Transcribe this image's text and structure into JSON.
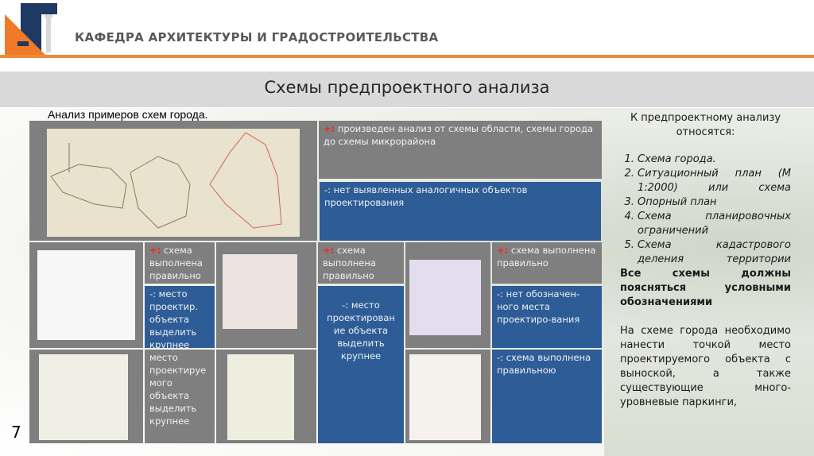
{
  "header": {
    "department": "КАФЕДРА АРХИТЕКТУРЫ И ГРАДОСТРОИТЕЛЬСТВА",
    "logo_text": "АГ"
  },
  "slide": {
    "title": "Схемы предпроектного анализа",
    "subtitle": "Анализ примеров схем города.",
    "page_number": "7"
  },
  "grid": {
    "top_plus": {
      "sign": "+:",
      "text": " произведен анализ от схемы области, схемы города до схемы микрорайона"
    },
    "top_minus": {
      "sign": "-:",
      "text": " нет выявленных аналогичных объектов проектирования"
    },
    "c1_plus": {
      "sign": "+:",
      "text": " схема выполнена правильно"
    },
    "c1_minus": "-:  место проектир. объекта выделить крупнее",
    "c1_row3": "место проектируе мого объекта выделить крупнее",
    "c3_plus": {
      "sign": "+:",
      "text": " схема выполнена правильно"
    },
    "c3_minus": "-:  место проектирован ие объекта выделить крупнее",
    "c5_plus": {
      "sign": "+:",
      "text": " схема выполнена правильно"
    },
    "c5_minus": "-:  нет обозначен-ного места проектиро-вания",
    "c5_row3": "-: схема выполнена правильною"
  },
  "right": {
    "heading": "К предпроектному анализу относятся:",
    "items": [
      "Схема города.",
      "Ситуационный план (М 1:2000) или схема",
      "Опорный план",
      "Схема планировочных ограничений",
      "Схема кадастрового деления территории"
    ],
    "bold_note": "Все схемы должны поясняться условными обозначениями",
    "paragraph": "На схеме города необходимо нанести точкой место проектируемого объекта с выноской, а также существующие много-уровневые паркинги,"
  },
  "colors": {
    "gray": "#7f7f7f",
    "blue": "#2e5c96",
    "orange": "#f08a3c",
    "navy": "#1f3864"
  }
}
